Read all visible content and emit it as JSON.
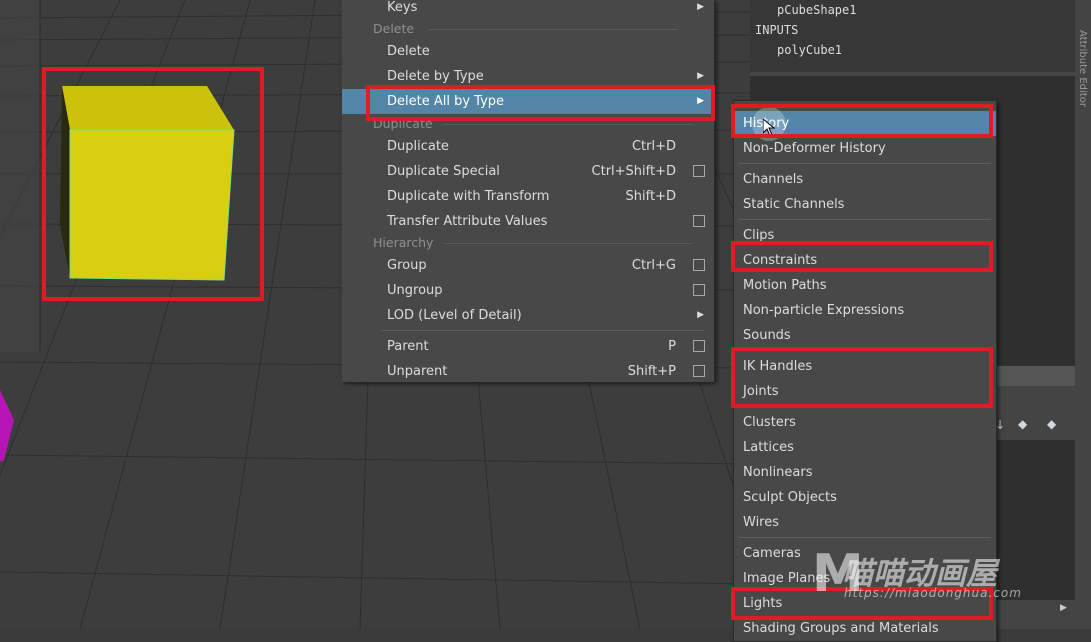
{
  "main_menu": {
    "keys": "Keys",
    "delete_section": "Delete",
    "delete": "Delete",
    "delete_by_type": "Delete by Type",
    "delete_all_by_type": "Delete All by Type",
    "duplicate_section": "Duplicate",
    "duplicate": "Duplicate",
    "duplicate_shortcut": "Ctrl+D",
    "duplicate_special": "Duplicate Special",
    "duplicate_special_shortcut": "Ctrl+Shift+D",
    "duplicate_with_transform": "Duplicate with Transform",
    "duplicate_with_transform_shortcut": "Shift+D",
    "transfer_attribute_values": "Transfer Attribute Values",
    "hierarchy_section": "Hierarchy",
    "group": "Group",
    "group_shortcut": "Ctrl+G",
    "ungroup": "Ungroup",
    "lod": "LOD (Level of Detail)",
    "parent": "Parent",
    "parent_shortcut": "P",
    "unparent": "Unparent",
    "unparent_shortcut": "Shift+P"
  },
  "submenu": {
    "history": "History",
    "non_deformer_history": "Non-Deformer History",
    "channels": "Channels",
    "static_channels": "Static Channels",
    "clips": "Clips",
    "constraints": "Constraints",
    "motion_paths": "Motion Paths",
    "non_particle_expressions": "Non-particle Expressions",
    "sounds": "Sounds",
    "ik_handles": "IK Handles",
    "joints": "Joints",
    "clusters": "Clusters",
    "lattices": "Lattices",
    "nonlinears": "Nonlinears",
    "sculpt_objects": "Sculpt Objects",
    "wires": "Wires",
    "cameras": "Cameras",
    "image_planes": "Image Planes",
    "lights": "Lights",
    "shading_groups": "Shading Groups and Materials"
  },
  "attribute_panel": {
    "shape_node": "pCubeShape1",
    "inputs_header": "INPUTS",
    "input_node": "polyCube1",
    "vertical_tab": "Attribute Editor"
  },
  "watermark": {
    "logo": "M",
    "title": "喵喵动画屋",
    "url": "https://miaodonghua.com"
  },
  "colors": {
    "cube": "#d8cf10",
    "highlight": "#5285a6",
    "annotation": "#e01b24"
  }
}
